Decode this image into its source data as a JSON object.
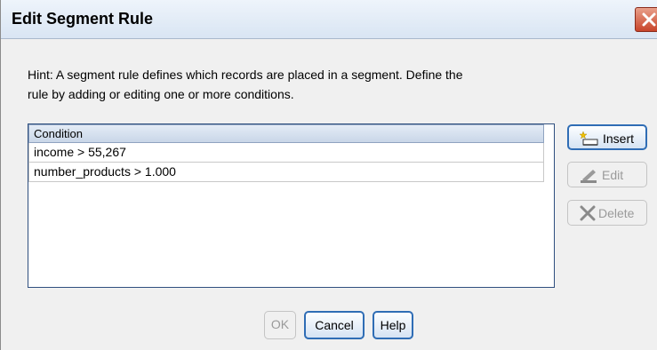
{
  "dialog": {
    "title": "Edit Segment Rule",
    "close_icon": "close-x-icon",
    "hint_line1": "Hint: A segment rule defines which records are placed in a segment. Define the",
    "hint_line2": "rule by adding or editing one or more conditions."
  },
  "conditions": {
    "header": "Condition",
    "rows": [
      "income > 55,267",
      "number_products > 1.000"
    ]
  },
  "side_buttons": {
    "insert": {
      "label": "Insert",
      "icon": "insert-icon",
      "enabled": true
    },
    "edit": {
      "label": "Edit",
      "icon": "edit-icon",
      "enabled": false
    },
    "delete": {
      "label": "Delete",
      "icon": "delete-x-icon",
      "enabled": false
    }
  },
  "footer_buttons": {
    "ok": {
      "label": "OK",
      "enabled": false
    },
    "cancel": {
      "label": "Cancel",
      "enabled": true
    },
    "help": {
      "label": "Help",
      "enabled": true
    }
  },
  "colors": {
    "accent_border": "#2f6db5",
    "close_red": "#c8442a"
  }
}
